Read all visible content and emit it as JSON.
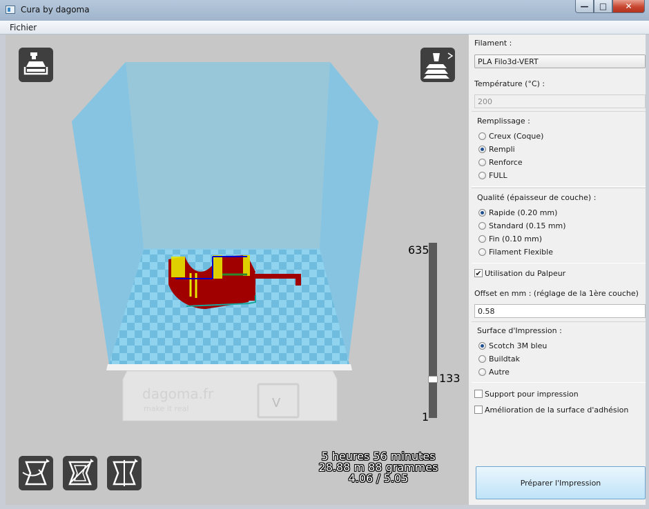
{
  "window": {
    "title": "Cura by dagoma",
    "minimize": "—",
    "maximize": "□",
    "close": "✕"
  },
  "menu": {
    "file": "Fichier"
  },
  "viewport": {
    "printer_brand": "dagoma.fr",
    "printer_slogan": "make it real",
    "printer_badge": "V",
    "layer_slider": {
      "max": "635",
      "current": "133",
      "min": "1",
      "fraction": 0.208
    },
    "stats": {
      "time": "5 heures 56 minutes",
      "material": "28.88 m 88 grammes",
      "ratio": "4.06 / 5.05"
    },
    "icons": {
      "load": "load-model-icon",
      "layers": "layer-view-icon",
      "rotate": "rotate-icon",
      "scale": "scale-icon",
      "mirror": "mirror-icon"
    }
  },
  "panel": {
    "filament_label": "Filament :",
    "filament_value": "PLA Filo3d-VERT",
    "temp_label": "Température (°C) :",
    "temp_value": "200",
    "fill_title": "Remplissage :",
    "fill_options": [
      "Creux (Coque)",
      "Rempli",
      "Renforce",
      "FULL"
    ],
    "fill_selected": 1,
    "quality_title": "Qualité (épaisseur de couche) :",
    "quality_options": [
      "Rapide (0.20 mm)",
      "Standard (0.15 mm)",
      "Fin (0.10 mm)",
      "Filament Flexible"
    ],
    "quality_selected": 0,
    "probe_label": "Utilisation du Palpeur",
    "probe_checked": true,
    "offset_label": "Offset en mm : (réglage de la 1ère couche)",
    "offset_value": "0.58",
    "surface_title": "Surface d'Impression :",
    "surface_options": [
      "Scotch 3M bleu",
      "Buildtak",
      "Autre"
    ],
    "surface_selected": 0,
    "support_label": "Support pour impression",
    "support_checked": false,
    "adhesion_label": "Amélioration de la surface d'adhésion",
    "adhesion_checked": false,
    "prepare_label": "Préparer l'Impression"
  },
  "colors": {
    "build_volume": "#8ecbe6",
    "bed_light": "#8fd3ee",
    "bed_dark": "#6fbcdf",
    "model": "#a00000",
    "support_yellow": "#e6e600",
    "icon_bg": "#3f3f3f"
  }
}
